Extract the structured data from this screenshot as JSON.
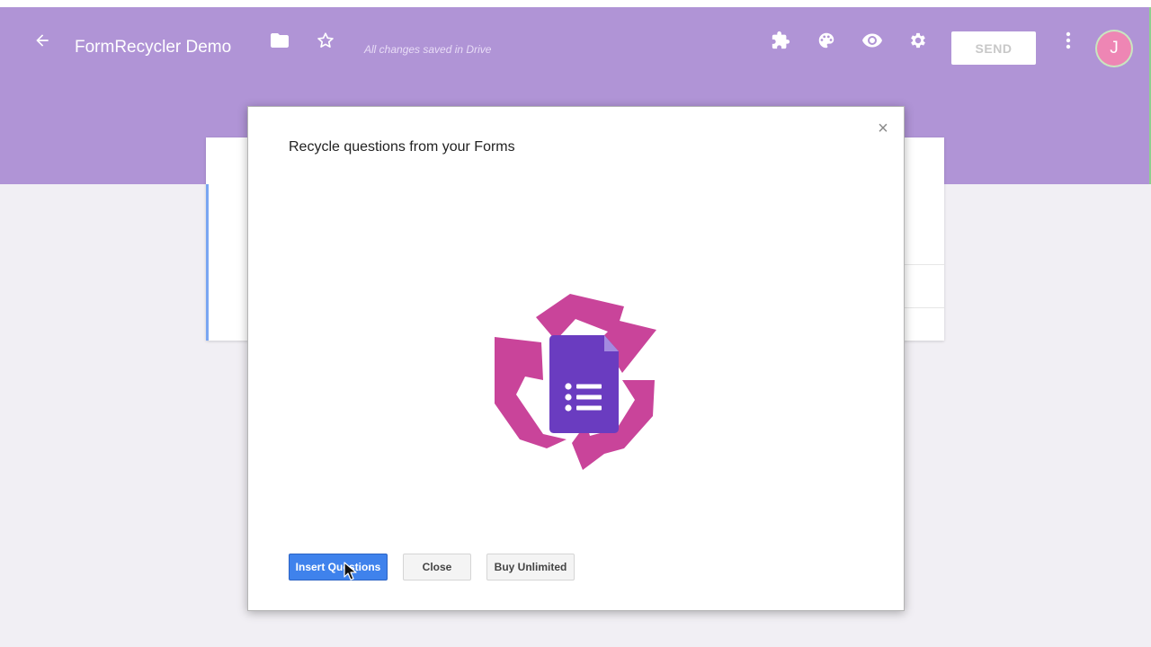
{
  "appbar": {
    "title": "FormRecycler Demo",
    "save_status": "All changes saved in Drive",
    "send_label": "SEND",
    "avatar_initial": "J",
    "icons": [
      "back-arrow-icon",
      "folder-icon",
      "star-icon",
      "puzzle-addon-icon",
      "palette-icon",
      "eye-preview-icon",
      "gear-icon",
      "more-vert-icon"
    ]
  },
  "dialog": {
    "title": "Recycle questions from your Forms",
    "close_glyph": "×",
    "logo": "recycle-forms-logo",
    "buttons": {
      "insert": "Insert Questions",
      "close": "Close",
      "buy": "Buy Unlimited"
    }
  },
  "colors": {
    "header": "#b094d6",
    "primary_button": "#3f82ec",
    "logo_recycle": "#c9449a",
    "logo_form": "#6a3cc0",
    "avatar": "#ee86b4"
  }
}
